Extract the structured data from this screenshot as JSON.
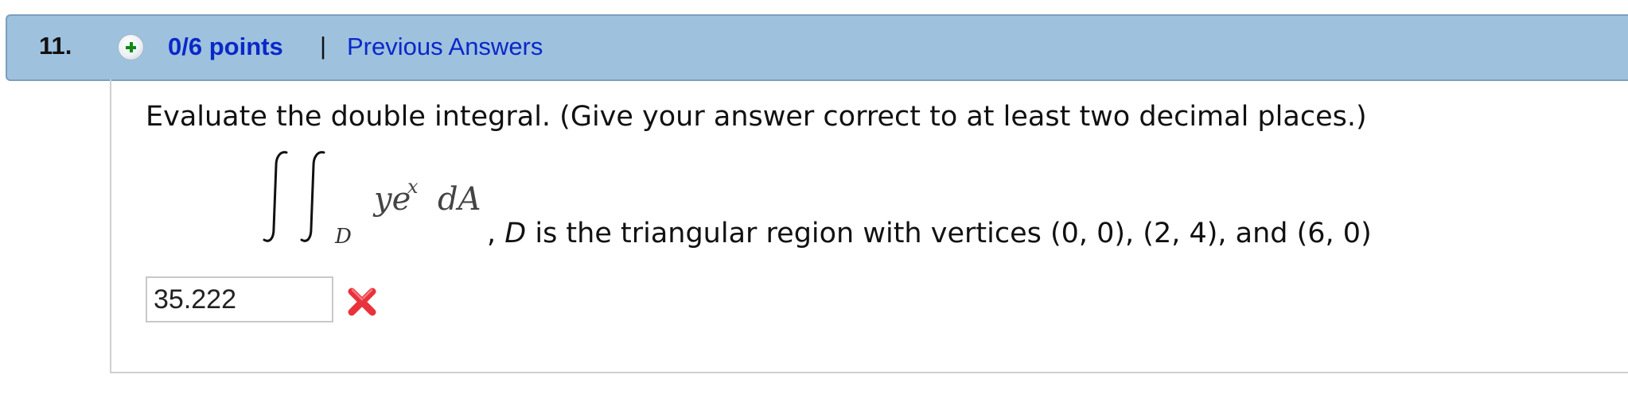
{
  "question": {
    "number": "11.",
    "points": "0/6 points",
    "separator": "|",
    "previous_answers_link": "Previous Answers"
  },
  "prompt": {
    "instruction": "Evaluate the double integral. (Give your answer correct to at least two decimal places.)",
    "integrand": "ye",
    "exponent": "x",
    "differential": "dA",
    "domain_subscript": "D",
    "region_prefix": ", ",
    "region_var": "D",
    "region_rest": " is the triangular region with vertices (0, 0), (2, 4), and (6, 0)"
  },
  "answer": {
    "value": "35.222",
    "status_icon": "red-x-icon"
  },
  "colors": {
    "header_bg": "#9ec1de",
    "link": "#0a28c8",
    "wrong": "#e8323c",
    "plus": "#0c8a14"
  }
}
